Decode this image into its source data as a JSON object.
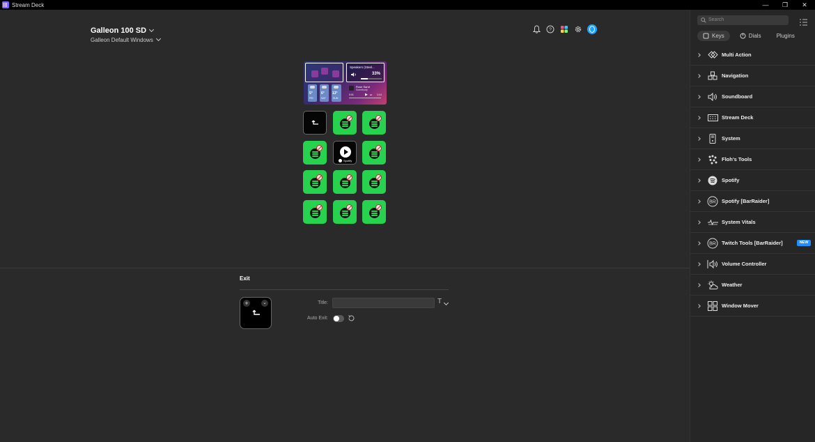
{
  "window": {
    "title": "Stream Deck",
    "minimize": "—",
    "restore": "❐",
    "close": "✕"
  },
  "header": {
    "device": "Galleon 100 SD",
    "profile": "Galleon Default Windows"
  },
  "lcd": {
    "speakers_label": "Speakers (Steel...",
    "volume": "33%",
    "weather": [
      {
        "temp": "5°",
        "day": "FRI"
      },
      {
        "temp": "6°",
        "day": "SAT"
      },
      {
        "temp": "13°",
        "day": "SUN"
      }
    ],
    "track_title": "Rose Sand",
    "track_artist": "Somebody",
    "time_elapsed": "0:01",
    "time_total": "1:14"
  },
  "keys": {
    "spotify_caption": "Spotify"
  },
  "properties": {
    "action_title": "Exit",
    "title_label": "Title:",
    "title_value": "",
    "auto_exit_label": "Auto Exit:",
    "auto_exit_on": false
  },
  "sidebar": {
    "search_placeholder": "Search",
    "tabs": [
      "Keys",
      "Dials",
      "Plugins"
    ],
    "categories": [
      {
        "label": "Multi Action",
        "icon": "multi-action-icon"
      },
      {
        "label": "Navigation",
        "icon": "navigation-icon"
      },
      {
        "label": "Soundboard",
        "icon": "soundboard-icon"
      },
      {
        "label": "Stream Deck",
        "icon": "stream-deck-icon"
      },
      {
        "label": "System",
        "icon": "system-icon"
      },
      {
        "label": "Floh's Tools",
        "icon": "flohs-tools-icon"
      },
      {
        "label": "Spotify",
        "icon": "spotify-icon"
      },
      {
        "label": "Spotify [BarRaider]",
        "icon": "barraider-icon"
      },
      {
        "label": "System Vitals",
        "icon": "system-vitals-icon"
      },
      {
        "label": "Twitch Tools [BarRaider]",
        "icon": "barraider-icon",
        "badge": "NEW"
      },
      {
        "label": "Volume Controller",
        "icon": "volume-controller-icon"
      },
      {
        "label": "Weather",
        "icon": "weather-icon"
      },
      {
        "label": "Window Mover",
        "icon": "window-mover-icon"
      }
    ]
  },
  "colors": {
    "accent": "#1f8fff",
    "spotify_green": "#27d24f",
    "background": "#2a2a2a",
    "sidebar": "#262626"
  }
}
